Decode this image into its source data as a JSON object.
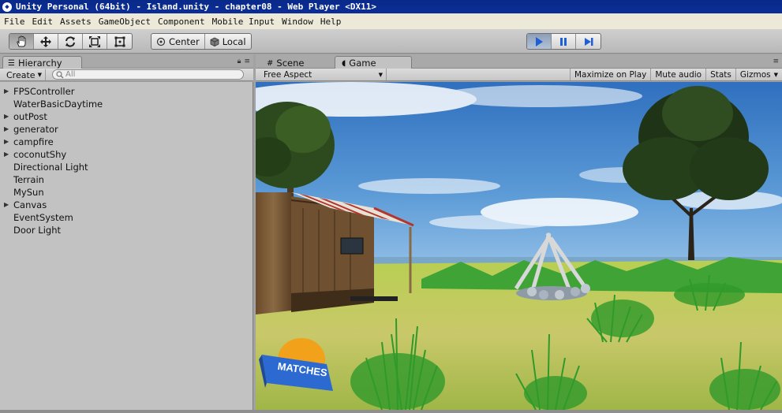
{
  "window": {
    "title": "Unity Personal (64bit) - Island.unity - chapter08 - Web Player <DX11>"
  },
  "menu": {
    "items": [
      "File",
      "Edit",
      "Assets",
      "GameObject",
      "Component",
      "Mobile Input",
      "Window",
      "Help"
    ]
  },
  "toolbar": {
    "transform_tools": [
      {
        "name": "hand",
        "icon": "hand-icon",
        "active": true
      },
      {
        "name": "move",
        "icon": "move-icon",
        "active": false
      },
      {
        "name": "rotate",
        "icon": "rotate-icon",
        "active": false
      },
      {
        "name": "scale",
        "icon": "scale-icon",
        "active": false
      },
      {
        "name": "rect",
        "icon": "rect-tool-icon",
        "active": false
      }
    ],
    "pivot_label": "Center",
    "space_label": "Local",
    "play_controls": [
      {
        "name": "play",
        "icon": "play-icon",
        "active": true
      },
      {
        "name": "pause",
        "icon": "pause-icon",
        "active": false
      },
      {
        "name": "step",
        "icon": "step-icon",
        "active": false
      }
    ]
  },
  "hierarchy": {
    "tab_label": "Hierarchy",
    "create_label": "Create",
    "search_placeholder": "All",
    "items": [
      {
        "label": "FPSController",
        "expandable": true
      },
      {
        "label": "WaterBasicDaytime",
        "expandable": false
      },
      {
        "label": "outPost",
        "expandable": true
      },
      {
        "label": "generator",
        "expandable": true
      },
      {
        "label": "campfire",
        "expandable": true
      },
      {
        "label": "coconutShy",
        "expandable": true
      },
      {
        "label": "Directional Light",
        "expandable": false
      },
      {
        "label": "Terrain",
        "expandable": false
      },
      {
        "label": "MySun",
        "expandable": false
      },
      {
        "label": "Canvas",
        "expandable": true
      },
      {
        "label": "EventSystem",
        "expandable": false
      },
      {
        "label": "Door Light",
        "expandable": false
      }
    ]
  },
  "game_panel": {
    "tabs": [
      {
        "label": "Scene",
        "active": false
      },
      {
        "label": "Game",
        "active": true
      }
    ],
    "aspect": "Free Aspect",
    "buttons": [
      "Maximize on Play",
      "Mute audio",
      "Stats",
      "Gizmos"
    ],
    "overlay_item_text": "MATCHES"
  },
  "colors": {
    "title_bar": "#0b2d95",
    "play_active": "#1f5fd6",
    "panel_bg": "#c2c2c2"
  }
}
